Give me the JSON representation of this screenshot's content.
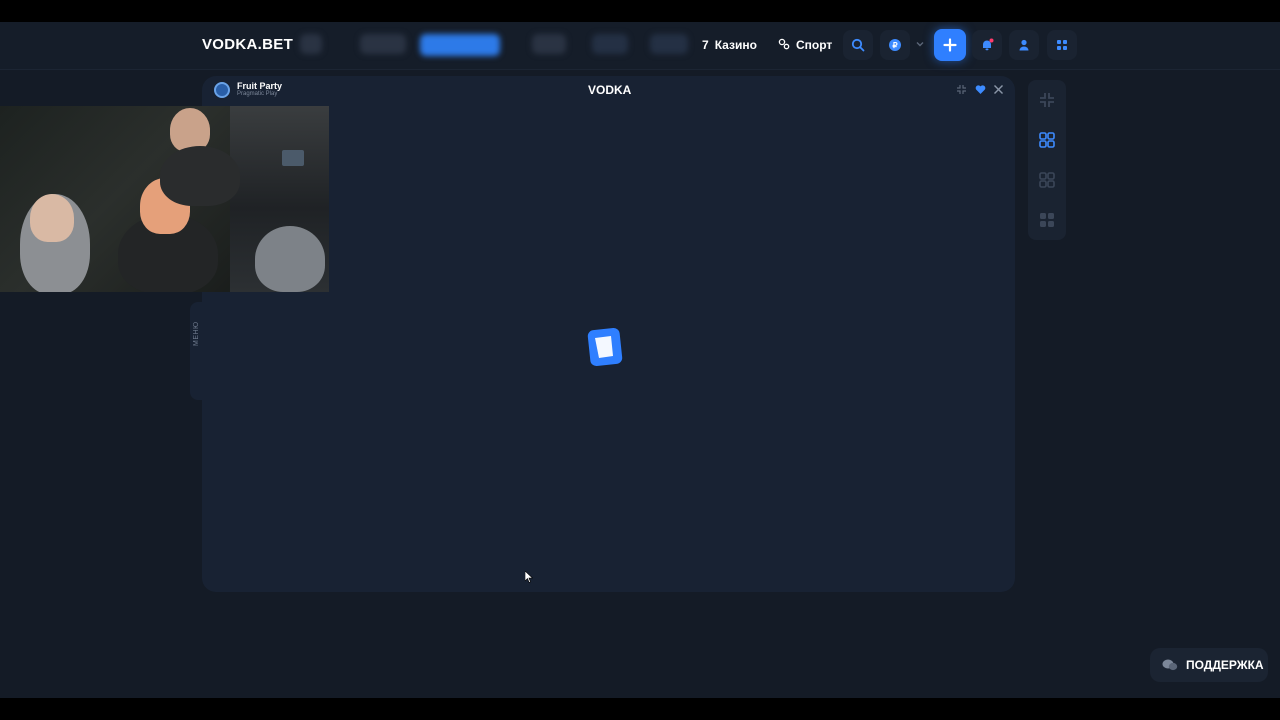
{
  "brand": {
    "logo_text": "VODKA.BET"
  },
  "nav": {
    "casino_label": "Казино",
    "sport_label": "Спорт"
  },
  "header_icons": [
    "search-icon",
    "currency-icon",
    "chevron-down-icon",
    "plus-icon",
    "bell-icon",
    "user-icon",
    "grid-icon"
  ],
  "game": {
    "title": "Fruit Party",
    "provider": "Pragmatic Play",
    "window_logo": "VODKA",
    "side_tab_label": "МЕНЮ"
  },
  "rail_icons": [
    "collapse-icon",
    "layout-single-icon",
    "layout-double-icon",
    "layout-quad-icon"
  ],
  "support": {
    "label": "ПОДДЕРЖКА"
  },
  "colors": {
    "accent": "#2f7fff",
    "background": "#141b26",
    "panel": "#182233",
    "notification": "#ff3b6b"
  }
}
